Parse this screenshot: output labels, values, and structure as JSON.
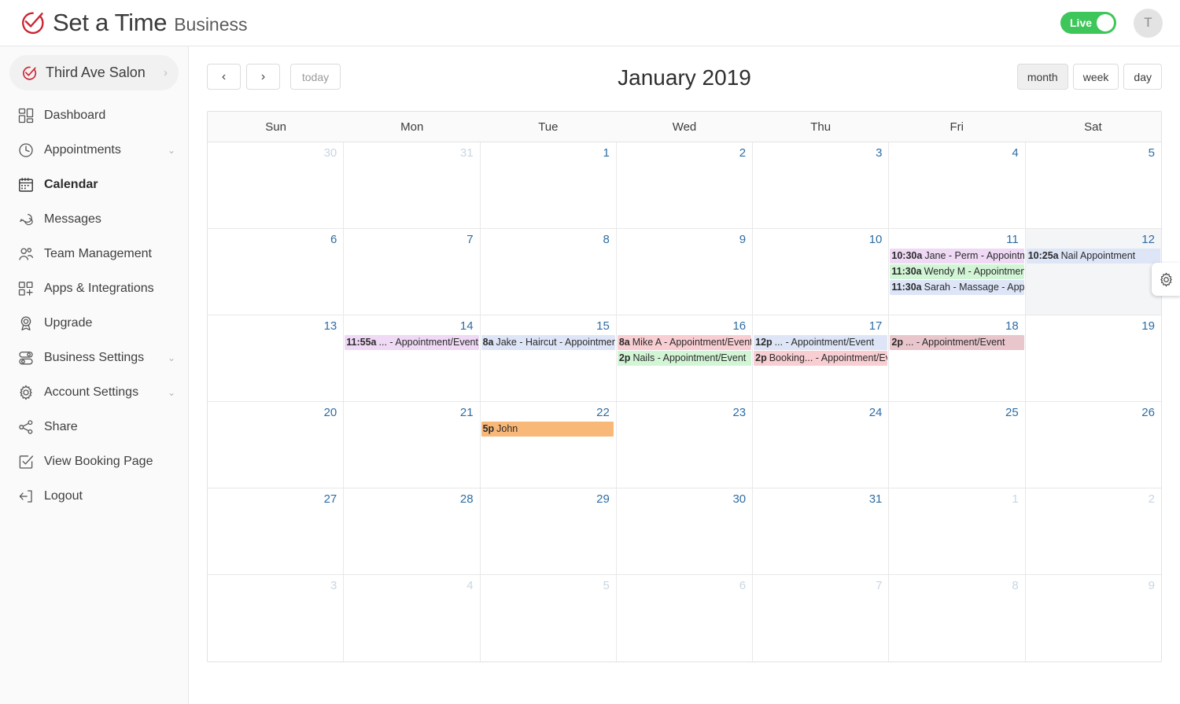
{
  "app": {
    "brand_name": "Set a Time",
    "brand_sub": "Business",
    "logo_icon": "checkmark-circle-logo",
    "live_label": "Live",
    "avatar_initial": "T"
  },
  "sidebar": {
    "business": {
      "name": "Third Ave Salon",
      "icon": "checkmark-circle-icon",
      "chevron": "›"
    },
    "items": [
      {
        "label": "Dashboard",
        "icon": "dashboard-grid-icon",
        "active": false,
        "caret": ""
      },
      {
        "label": "Appointments",
        "icon": "clock-icon",
        "active": false,
        "caret": "⌄"
      },
      {
        "label": "Calendar",
        "icon": "calendar-icon",
        "active": true,
        "caret": ""
      },
      {
        "label": "Messages",
        "icon": "chat-bubbles-icon",
        "active": false,
        "caret": ""
      },
      {
        "label": "Team Management",
        "icon": "users-icon",
        "active": false,
        "caret": ""
      },
      {
        "label": "Apps & Integrations",
        "icon": "apps-plus-icon",
        "active": false,
        "caret": ""
      },
      {
        "label": "Upgrade",
        "icon": "award-ribbon-icon",
        "active": false,
        "caret": ""
      },
      {
        "label": "Business Settings",
        "icon": "toggles-icon",
        "active": false,
        "caret": "⌄"
      },
      {
        "label": "Account Settings",
        "icon": "gear-icon",
        "active": false,
        "caret": "⌄"
      },
      {
        "label": "Share",
        "icon": "share-nodes-icon",
        "active": false,
        "caret": ""
      },
      {
        "label": "View Booking Page",
        "icon": "checkbox-square-icon",
        "active": false,
        "caret": ""
      },
      {
        "label": "Logout",
        "icon": "logout-arrow-icon",
        "active": false,
        "caret": ""
      }
    ]
  },
  "toolbar": {
    "prev_label": "‹",
    "next_label": "›",
    "today_label": "today",
    "title": "January 2019",
    "views": [
      {
        "label": "month",
        "active": true
      },
      {
        "label": "week",
        "active": false
      },
      {
        "label": "day",
        "active": false
      }
    ],
    "settings_icon": "gear-icon"
  },
  "calendar": {
    "day_headers": [
      "Sun",
      "Mon",
      "Tue",
      "Wed",
      "Thu",
      "Fri",
      "Sat"
    ],
    "colors": {
      "purple": "#efd9f5",
      "green": "#d2f5d6",
      "blue": "#dde5f7",
      "red": "#f8ced2",
      "orange": "#f8b878",
      "pink": "#e8c6cc",
      "date_blue": "#2e6da4",
      "date_muted": "#c8d6e3",
      "today_bg": "#f4f5f7"
    },
    "weeks": [
      {
        "days": [
          {
            "num": "30",
            "other": true,
            "today": false,
            "events": []
          },
          {
            "num": "31",
            "other": true,
            "today": false,
            "events": []
          },
          {
            "num": "1",
            "other": false,
            "today": false,
            "events": []
          },
          {
            "num": "2",
            "other": false,
            "today": false,
            "events": []
          },
          {
            "num": "3",
            "other": false,
            "today": false,
            "events": []
          },
          {
            "num": "4",
            "other": false,
            "today": false,
            "events": []
          },
          {
            "num": "5",
            "other": false,
            "today": false,
            "events": []
          }
        ]
      },
      {
        "days": [
          {
            "num": "6",
            "other": false,
            "today": false,
            "events": []
          },
          {
            "num": "7",
            "other": false,
            "today": false,
            "events": []
          },
          {
            "num": "8",
            "other": false,
            "today": false,
            "events": []
          },
          {
            "num": "9",
            "other": false,
            "today": false,
            "events": []
          },
          {
            "num": "10",
            "other": false,
            "today": false,
            "events": []
          },
          {
            "num": "11",
            "other": false,
            "today": false,
            "events": [
              {
                "time": "10:30a",
                "title": "Jane - Perm - Appointment/Event",
                "color": "purple",
                "wide": true
              },
              {
                "time": "11:30a",
                "title": "Wendy M - Appointment/Event",
                "color": "green",
                "wide": true
              },
              {
                "time": "11:30a",
                "title": "Sarah - Massage - Appointment/Event",
                "color": "blue",
                "wide": true
              }
            ]
          },
          {
            "num": "12",
            "other": false,
            "today": true,
            "events": [
              {
                "time": "10:25a",
                "title": "Nail Appointment",
                "color": "blue",
                "wide": true
              }
            ]
          }
        ]
      },
      {
        "days": [
          {
            "num": "13",
            "other": false,
            "today": false,
            "events": []
          },
          {
            "num": "14",
            "other": false,
            "today": false,
            "events": [
              {
                "time": "11:55a",
                "title": "... - Appointment/Event",
                "color": "purple",
                "wide": true
              }
            ]
          },
          {
            "num": "15",
            "other": false,
            "today": false,
            "events": [
              {
                "time": "8a",
                "title": "Jake - Haircut - Appointment/Event",
                "color": "blue",
                "wide": true
              }
            ]
          },
          {
            "num": "16",
            "other": false,
            "today": false,
            "events": [
              {
                "time": "8a",
                "title": "Mike A - Appointment/Event",
                "color": "red",
                "wide": true
              },
              {
                "time": "2p",
                "title": "Nails - Appointment/Event",
                "color": "green",
                "wide": true
              }
            ]
          },
          {
            "num": "17",
            "other": false,
            "today": false,
            "events": [
              {
                "time": "12p",
                "title": "... - Appointment/Event",
                "color": "blue",
                "wide": true
              },
              {
                "time": "2p",
                "title": "Booking... - Appointment/Event",
                "color": "red",
                "wide": true
              }
            ]
          },
          {
            "num": "18",
            "other": false,
            "today": false,
            "events": [
              {
                "time": "2p",
                "title": "... - Appointment/Event",
                "color": "pink",
                "wide": true
              }
            ]
          },
          {
            "num": "19",
            "other": false,
            "today": false,
            "events": []
          }
        ]
      },
      {
        "days": [
          {
            "num": "20",
            "other": false,
            "today": false,
            "events": []
          },
          {
            "num": "21",
            "other": false,
            "today": false,
            "events": []
          },
          {
            "num": "22",
            "other": false,
            "today": false,
            "events": [
              {
                "time": "5p",
                "title": "John",
                "color": "orange",
                "wide": false
              }
            ]
          },
          {
            "num": "23",
            "other": false,
            "today": false,
            "events": []
          },
          {
            "num": "24",
            "other": false,
            "today": false,
            "events": []
          },
          {
            "num": "25",
            "other": false,
            "today": false,
            "events": []
          },
          {
            "num": "26",
            "other": false,
            "today": false,
            "events": []
          }
        ]
      },
      {
        "days": [
          {
            "num": "27",
            "other": false,
            "today": false,
            "events": []
          },
          {
            "num": "28",
            "other": false,
            "today": false,
            "events": []
          },
          {
            "num": "29",
            "other": false,
            "today": false,
            "events": []
          },
          {
            "num": "30",
            "other": false,
            "today": false,
            "events": []
          },
          {
            "num": "31",
            "other": false,
            "today": false,
            "events": []
          },
          {
            "num": "1",
            "other": true,
            "today": false,
            "events": []
          },
          {
            "num": "2",
            "other": true,
            "today": false,
            "events": []
          }
        ]
      },
      {
        "days": [
          {
            "num": "3",
            "other": true,
            "today": false,
            "events": []
          },
          {
            "num": "4",
            "other": true,
            "today": false,
            "events": []
          },
          {
            "num": "5",
            "other": true,
            "today": false,
            "events": []
          },
          {
            "num": "6",
            "other": true,
            "today": false,
            "events": []
          },
          {
            "num": "7",
            "other": true,
            "today": false,
            "events": []
          },
          {
            "num": "8",
            "other": true,
            "today": false,
            "events": []
          },
          {
            "num": "9",
            "other": true,
            "today": false,
            "events": []
          }
        ]
      }
    ]
  }
}
